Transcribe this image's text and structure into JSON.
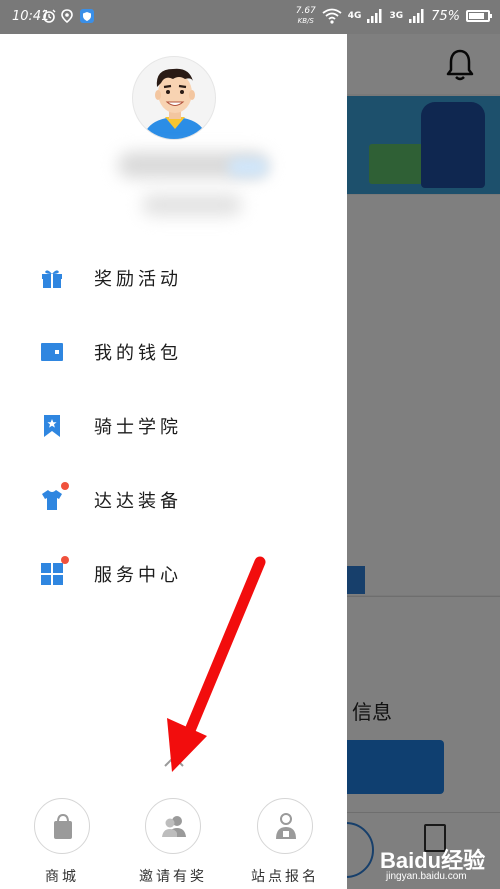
{
  "status_bar": {
    "time": "10:41",
    "net_speed_value": "7.67",
    "net_speed_unit": "KB/S",
    "signal1": "4G",
    "signal2": "3G",
    "battery": "75%",
    "icons": [
      "alarm-icon",
      "location-icon",
      "shield-app-icon",
      "wifi-icon",
      "signal-icon",
      "battery-icon"
    ]
  },
  "drawer": {
    "avatar_icon": "user-avatar",
    "menu": [
      {
        "label": "奖励活动",
        "icon": "gift-icon",
        "badge": false
      },
      {
        "label": "我的钱包",
        "icon": "wallet-icon",
        "badge": false
      },
      {
        "label": "骑士学院",
        "icon": "bookmark-star-icon",
        "badge": false
      },
      {
        "label": "达达装备",
        "icon": "shirt-icon",
        "badge": true
      },
      {
        "label": "服务中心",
        "icon": "grid-icon",
        "badge": true
      }
    ],
    "bottom": [
      {
        "label": "商城",
        "icon": "shopping-bag-icon"
      },
      {
        "label": "邀请有奖",
        "icon": "invite-users-icon"
      },
      {
        "label": "站点报名",
        "icon": "lock-user-icon"
      }
    ]
  },
  "background": {
    "info_text": "信息"
  },
  "watermark": {
    "logo": "Baidu经验",
    "url": "jingyan.baidu.com"
  },
  "colors": {
    "accent_blue": "#2f86e0",
    "badge_red": "#f0513c",
    "annotation_red": "#f20d0d",
    "dim_overlay": "rgba(0,0,0,0.5)"
  }
}
